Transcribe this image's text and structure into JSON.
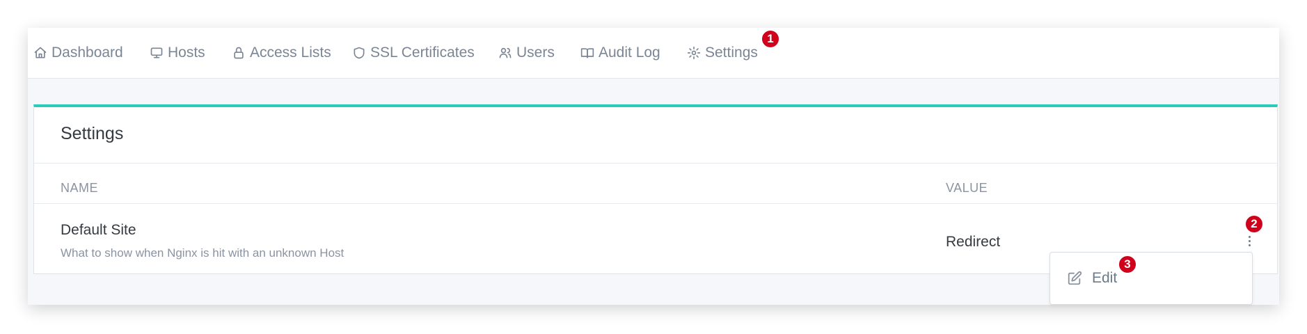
{
  "nav": {
    "items": [
      {
        "label": "Dashboard",
        "icon": "home-icon"
      },
      {
        "label": "Hosts",
        "icon": "monitor-icon"
      },
      {
        "label": "Access Lists",
        "icon": "lock-icon"
      },
      {
        "label": "SSL Certificates",
        "icon": "shield-icon"
      },
      {
        "label": "Users",
        "icon": "users-icon"
      },
      {
        "label": "Audit Log",
        "icon": "book-icon"
      },
      {
        "label": "Settings",
        "icon": "gear-icon"
      }
    ]
  },
  "steps": {
    "one": "1",
    "two": "2",
    "three": "3"
  },
  "settings_card": {
    "title": "Settings",
    "columns": {
      "name": "NAME",
      "value": "VALUE"
    },
    "rows": [
      {
        "name": "Default Site",
        "description": "What to show when Nginx is hit with an unknown Host",
        "value": "Redirect"
      }
    ],
    "accent_color": "#2bcbba"
  },
  "row_menu": {
    "items": [
      {
        "label": "Edit",
        "icon": "edit-icon"
      }
    ]
  },
  "badge_color": "#d0021b"
}
